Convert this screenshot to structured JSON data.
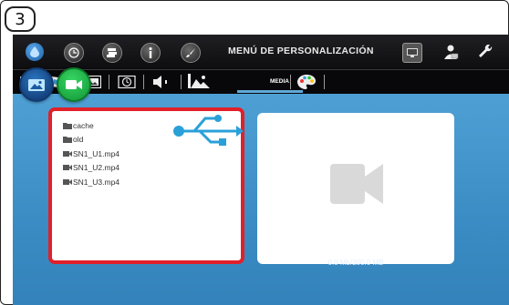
{
  "step_marker": "3",
  "header": {
    "title": "MENÚ DE PERSONALIZACIÓN"
  },
  "toolbar": {
    "media_label": "MEDIA"
  },
  "files": [
    {
      "name": "cache",
      "type": "folder"
    },
    {
      "name": "old",
      "type": "folder"
    },
    {
      "name": "SN1_U1.mp4",
      "type": "video"
    },
    {
      "name": "SN1_U2.mp4",
      "type": "video"
    },
    {
      "name": "SN1_U3.mp4",
      "type": "video"
    }
  ],
  "storage_usage": "0.0 Mb/200.0 MB",
  "colors": {
    "highlight": "#e0202a",
    "content_bg": "#3f90c8",
    "usb_icon": "#2aa0d8",
    "green_button": "#1fb84a"
  },
  "icons": {
    "top_bar": [
      "water-drop-icon",
      "clock-icon",
      "stack-icon",
      "info-icon",
      "brush-icon",
      "screen-icon",
      "person-icon",
      "wrench-icon"
    ],
    "toolbar": [
      "book-icon",
      "book-blue-icon",
      "image-icon",
      "timer-icon",
      "speaker-icon",
      "media-icon",
      "palette-icon"
    ],
    "source_buttons": [
      "image-source-icon",
      "video-source-icon"
    ],
    "usb": "usb-icon",
    "preview": "video-camera-icon"
  }
}
